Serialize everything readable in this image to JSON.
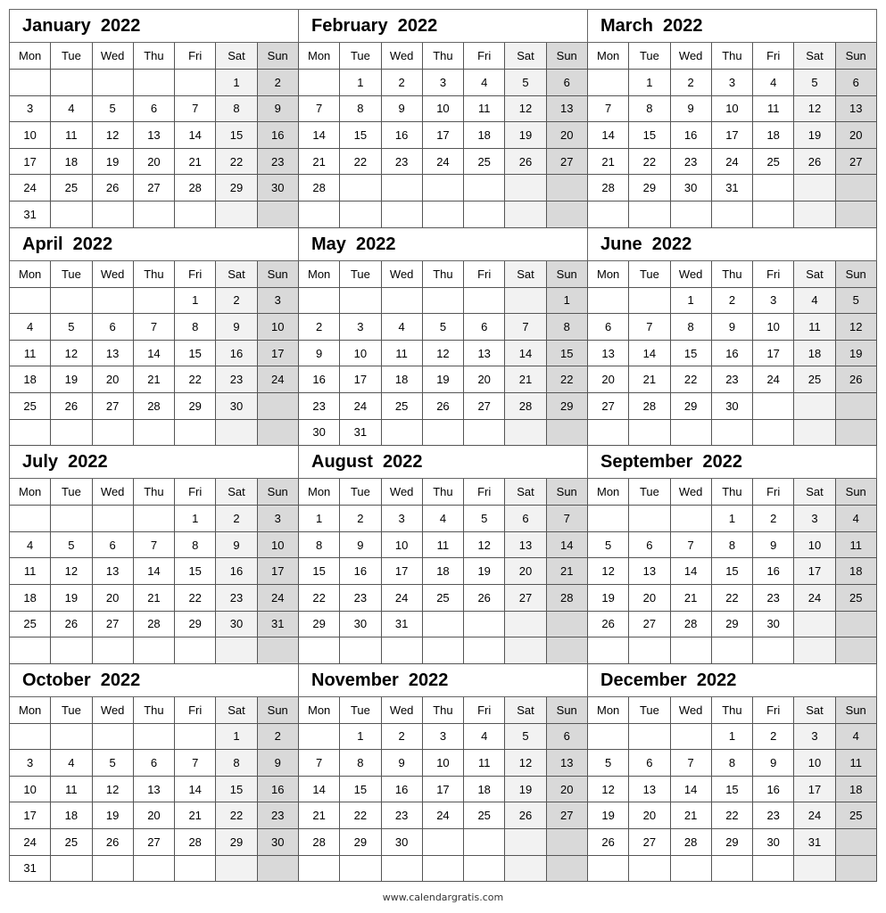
{
  "weekdays": [
    "Mon",
    "Tue",
    "Wed",
    "Thu",
    "Fri",
    "Sat",
    "Sun"
  ],
  "colors": {
    "saturday": "#f2f2f2",
    "sunday": "#d9d9d9",
    "border": "#555555"
  },
  "months": [
    {
      "title": "January  2022",
      "weeks": [
        [
          "",
          "",
          "",
          "",
          "",
          "1",
          "2"
        ],
        [
          "3",
          "4",
          "5",
          "6",
          "7",
          "8",
          "9"
        ],
        [
          "10",
          "11",
          "12",
          "13",
          "14",
          "15",
          "16"
        ],
        [
          "17",
          "18",
          "19",
          "20",
          "21",
          "22",
          "23"
        ],
        [
          "24",
          "25",
          "26",
          "27",
          "28",
          "29",
          "30"
        ],
        [
          "31",
          "",
          "",
          "",
          "",
          "",
          ""
        ]
      ]
    },
    {
      "title": "February  2022",
      "weeks": [
        [
          "",
          "1",
          "2",
          "3",
          "4",
          "5",
          "6"
        ],
        [
          "7",
          "8",
          "9",
          "10",
          "11",
          "12",
          "13"
        ],
        [
          "14",
          "15",
          "16",
          "17",
          "18",
          "19",
          "20"
        ],
        [
          "21",
          "22",
          "23",
          "24",
          "25",
          "26",
          "27"
        ],
        [
          "28",
          "",
          "",
          "",
          "",
          "",
          ""
        ],
        [
          "",
          "",
          "",
          "",
          "",
          "",
          ""
        ]
      ]
    },
    {
      "title": "March  2022",
      "weeks": [
        [
          "",
          "1",
          "2",
          "3",
          "4",
          "5",
          "6"
        ],
        [
          "7",
          "8",
          "9",
          "10",
          "11",
          "12",
          "13"
        ],
        [
          "14",
          "15",
          "16",
          "17",
          "18",
          "19",
          "20"
        ],
        [
          "21",
          "22",
          "23",
          "24",
          "25",
          "26",
          "27"
        ],
        [
          "28",
          "29",
          "30",
          "31",
          "",
          "",
          ""
        ],
        [
          "",
          "",
          "",
          "",
          "",
          "",
          ""
        ]
      ]
    },
    {
      "title": "April  2022",
      "weeks": [
        [
          "",
          "",
          "",
          "",
          "1",
          "2",
          "3"
        ],
        [
          "4",
          "5",
          "6",
          "7",
          "8",
          "9",
          "10"
        ],
        [
          "11",
          "12",
          "13",
          "14",
          "15",
          "16",
          "17"
        ],
        [
          "18",
          "19",
          "20",
          "21",
          "22",
          "23",
          "24"
        ],
        [
          "25",
          "26",
          "27",
          "28",
          "29",
          "30",
          ""
        ],
        [
          "",
          "",
          "",
          "",
          "",
          "",
          ""
        ]
      ]
    },
    {
      "title": "May  2022",
      "weeks": [
        [
          "",
          "",
          "",
          "",
          "",
          "",
          "1"
        ],
        [
          "2",
          "3",
          "4",
          "5",
          "6",
          "7",
          "8"
        ],
        [
          "9",
          "10",
          "11",
          "12",
          "13",
          "14",
          "15"
        ],
        [
          "16",
          "17",
          "18",
          "19",
          "20",
          "21",
          "22"
        ],
        [
          "23",
          "24",
          "25",
          "26",
          "27",
          "28",
          "29"
        ],
        [
          "30",
          "31",
          "",
          "",
          "",
          "",
          ""
        ]
      ]
    },
    {
      "title": "June  2022",
      "weeks": [
        [
          "",
          "",
          "1",
          "2",
          "3",
          "4",
          "5"
        ],
        [
          "6",
          "7",
          "8",
          "9",
          "10",
          "11",
          "12"
        ],
        [
          "13",
          "14",
          "15",
          "16",
          "17",
          "18",
          "19"
        ],
        [
          "20",
          "21",
          "22",
          "23",
          "24",
          "25",
          "26"
        ],
        [
          "27",
          "28",
          "29",
          "30",
          "",
          "",
          ""
        ],
        [
          "",
          "",
          "",
          "",
          "",
          "",
          ""
        ]
      ]
    },
    {
      "title": "July  2022",
      "weeks": [
        [
          "",
          "",
          "",
          "",
          "1",
          "2",
          "3"
        ],
        [
          "4",
          "5",
          "6",
          "7",
          "8",
          "9",
          "10"
        ],
        [
          "11",
          "12",
          "13",
          "14",
          "15",
          "16",
          "17"
        ],
        [
          "18",
          "19",
          "20",
          "21",
          "22",
          "23",
          "24"
        ],
        [
          "25",
          "26",
          "27",
          "28",
          "29",
          "30",
          "31"
        ],
        [
          "",
          "",
          "",
          "",
          "",
          "",
          ""
        ]
      ]
    },
    {
      "title": "August  2022",
      "weeks": [
        [
          "1",
          "2",
          "3",
          "4",
          "5",
          "6",
          "7"
        ],
        [
          "8",
          "9",
          "10",
          "11",
          "12",
          "13",
          "14"
        ],
        [
          "15",
          "16",
          "17",
          "18",
          "19",
          "20",
          "21"
        ],
        [
          "22",
          "23",
          "24",
          "25",
          "26",
          "27",
          "28"
        ],
        [
          "29",
          "30",
          "31",
          "",
          "",
          "",
          ""
        ],
        [
          "",
          "",
          "",
          "",
          "",
          "",
          ""
        ]
      ]
    },
    {
      "title": "September  2022",
      "weeks": [
        [
          "",
          "",
          "",
          "1",
          "2",
          "3",
          "4"
        ],
        [
          "5",
          "6",
          "7",
          "8",
          "9",
          "10",
          "11"
        ],
        [
          "12",
          "13",
          "14",
          "15",
          "16",
          "17",
          "18"
        ],
        [
          "19",
          "20",
          "21",
          "22",
          "23",
          "24",
          "25"
        ],
        [
          "26",
          "27",
          "28",
          "29",
          "30",
          "",
          ""
        ],
        [
          "",
          "",
          "",
          "",
          "",
          "",
          ""
        ]
      ]
    },
    {
      "title": "October  2022",
      "weeks": [
        [
          "",
          "",
          "",
          "",
          "",
          "1",
          "2"
        ],
        [
          "3",
          "4",
          "5",
          "6",
          "7",
          "8",
          "9"
        ],
        [
          "10",
          "11",
          "12",
          "13",
          "14",
          "15",
          "16"
        ],
        [
          "17",
          "18",
          "19",
          "20",
          "21",
          "22",
          "23"
        ],
        [
          "24",
          "25",
          "26",
          "27",
          "28",
          "29",
          "30"
        ],
        [
          "31",
          "",
          "",
          "",
          "",
          "",
          ""
        ]
      ]
    },
    {
      "title": "November  2022",
      "weeks": [
        [
          "",
          "1",
          "2",
          "3",
          "4",
          "5",
          "6"
        ],
        [
          "7",
          "8",
          "9",
          "10",
          "11",
          "12",
          "13"
        ],
        [
          "14",
          "15",
          "16",
          "17",
          "18",
          "19",
          "20"
        ],
        [
          "21",
          "22",
          "23",
          "24",
          "25",
          "26",
          "27"
        ],
        [
          "28",
          "29",
          "30",
          "",
          "",
          "",
          ""
        ],
        [
          "",
          "",
          "",
          "",
          "",
          "",
          ""
        ]
      ]
    },
    {
      "title": "December  2022",
      "weeks": [
        [
          "",
          "",
          "",
          "1",
          "2",
          "3",
          "4"
        ],
        [
          "5",
          "6",
          "7",
          "8",
          "9",
          "10",
          "11"
        ],
        [
          "12",
          "13",
          "14",
          "15",
          "16",
          "17",
          "18"
        ],
        [
          "19",
          "20",
          "21",
          "22",
          "23",
          "24",
          "25"
        ],
        [
          "26",
          "27",
          "28",
          "29",
          "30",
          "31",
          ""
        ],
        [
          "",
          "",
          "",
          "",
          "",
          "",
          ""
        ]
      ]
    }
  ],
  "footer": "www.calendargratis.com"
}
